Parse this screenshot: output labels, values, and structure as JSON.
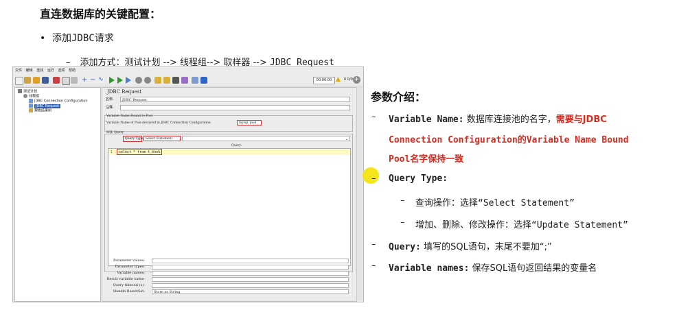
{
  "slide": {
    "heading": "直连数据库的关键配置：",
    "bullet_marker": "•",
    "bullet_prefix": "添加",
    "bullet_code": "JDBC",
    "bullet_suffix": "请求",
    "subpath_dash": "–",
    "subpath_text": "添加方式：测试计划 --> 线程组--> 取样器 --> ",
    "subpath_code": "JDBC Request"
  },
  "jmeter": {
    "menu": [
      "文件",
      "编辑",
      "查找",
      "运行",
      "选项",
      "帮助"
    ],
    "timer": "00:00:00",
    "warning_count": "0  0/0",
    "tree": {
      "test_plan": "测试计划",
      "thread_group": "线程组",
      "jdbc_config": "JDBC Connection Configuration",
      "jdbc_request": "JDBC Request",
      "results_tree": "察看结果树"
    },
    "panel": {
      "title": "JDBC Request",
      "name_label": "名称:",
      "name_value": "JDBC Request",
      "comment_label": "注释:",
      "pool_group": "Variable Name Bound to Pool",
      "pool_label": "Variable Name of Pool declared in JDBC Connection Configuration",
      "pool_value": "mysql_pool",
      "sql_group": "SQL Query",
      "query_type_label": "Query Type:",
      "query_type_value": "Select Statement",
      "query_header": "Query:",
      "line_number": "1",
      "query_text": "select * from t_book",
      "bottom_rows": [
        {
          "label": "Parameter values:",
          "value": ""
        },
        {
          "label": "Parameter types:",
          "value": ""
        },
        {
          "label": "Variable names:",
          "value": ""
        },
        {
          "label": "Result variable name:",
          "value": ""
        },
        {
          "label": "Query timeout (s):",
          "value": ""
        },
        {
          "label": "Handle ResultSet:",
          "value": "Store as String"
        }
      ]
    }
  },
  "params": {
    "title": "参数介绍：",
    "vn_dash": "–",
    "vn_key": "Variable Name:",
    "vn_desc": " 数据库连接池的名字，",
    "vn_red1": "需要与JDBC",
    "vn_red2": "Connection Configuration的Variable Name Bound",
    "vn_red3": "Pool名字保持一致",
    "qt_dash": "–",
    "qt_key": "Query Type:",
    "sub1_dash": "–",
    "sub1_text": "查询操作：选择",
    "sub1_code": "“Select Statement”",
    "sub2_dash": "–",
    "sub2_text": "增加、删除、修改操作：选择",
    "sub2_code": "“Update Statement”",
    "q_dash": "–",
    "q_key": "Query:",
    "q_desc": " 填写的SQL语句，末尾不要加“;”",
    "vns_dash": "–",
    "vns_key": "Variable names:",
    "vns_desc": " 保存SQL语句返回结果的变量名"
  },
  "colors": {
    "accent_red": "#d62b1f",
    "highlight_yellow": "#f5e61b",
    "tree_selection": "#2e5fb3"
  }
}
